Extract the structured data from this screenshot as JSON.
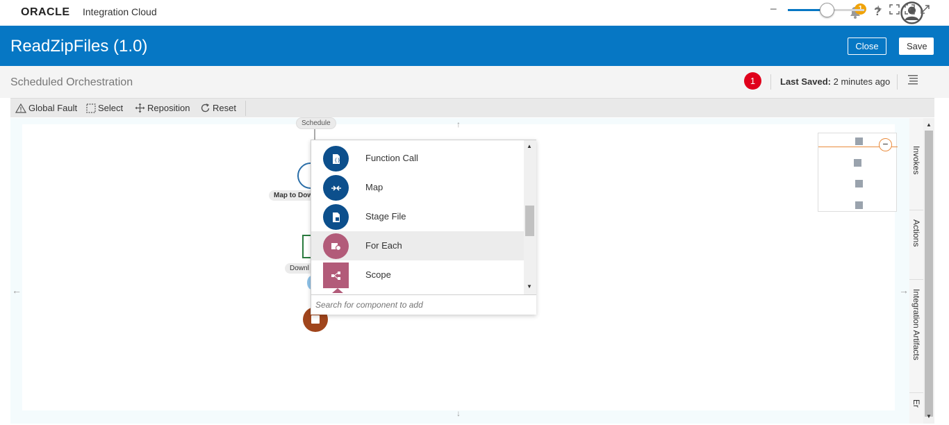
{
  "brand": {
    "logo": "ORACLE",
    "product": "Integration Cloud"
  },
  "notifications": {
    "count": "1",
    "icon": "bell-icon"
  },
  "help": {
    "label": "?"
  },
  "header": {
    "title": "ReadZipFiles (1.0)",
    "close_label": "Close",
    "save_label": "Save",
    "background": "#0677c4"
  },
  "subheader": {
    "title": "Scheduled Orchestration",
    "error_count": "1",
    "last_saved_label": "Last Saved:",
    "last_saved_value": "2 minutes ago"
  },
  "toolbar": {
    "global_fault": "Global Fault",
    "select": "Select",
    "reposition": "Reposition",
    "reset": "Reset",
    "zoom_level": 0.5
  },
  "canvas": {
    "nodes": {
      "schedule": "Schedule",
      "map": "Map to Dow",
      "download": "Downl"
    }
  },
  "palette": {
    "items": [
      {
        "label": "Function Call",
        "icon": "function-call-icon",
        "color": "#0c4f8c"
      },
      {
        "label": "Map",
        "icon": "map-icon",
        "color": "#0c4f8c"
      },
      {
        "label": "Stage File",
        "icon": "stage-file-icon",
        "color": "#0c4f8c"
      },
      {
        "label": "For Each",
        "icon": "for-each-icon",
        "color": "#b25b79"
      },
      {
        "label": "Scope",
        "icon": "scope-icon",
        "color": "#b25b79"
      }
    ],
    "search_placeholder": "Search for component to add"
  },
  "rail": {
    "tabs": [
      "Invokes",
      "Actions",
      "Integration Artifacts",
      "Er"
    ]
  }
}
